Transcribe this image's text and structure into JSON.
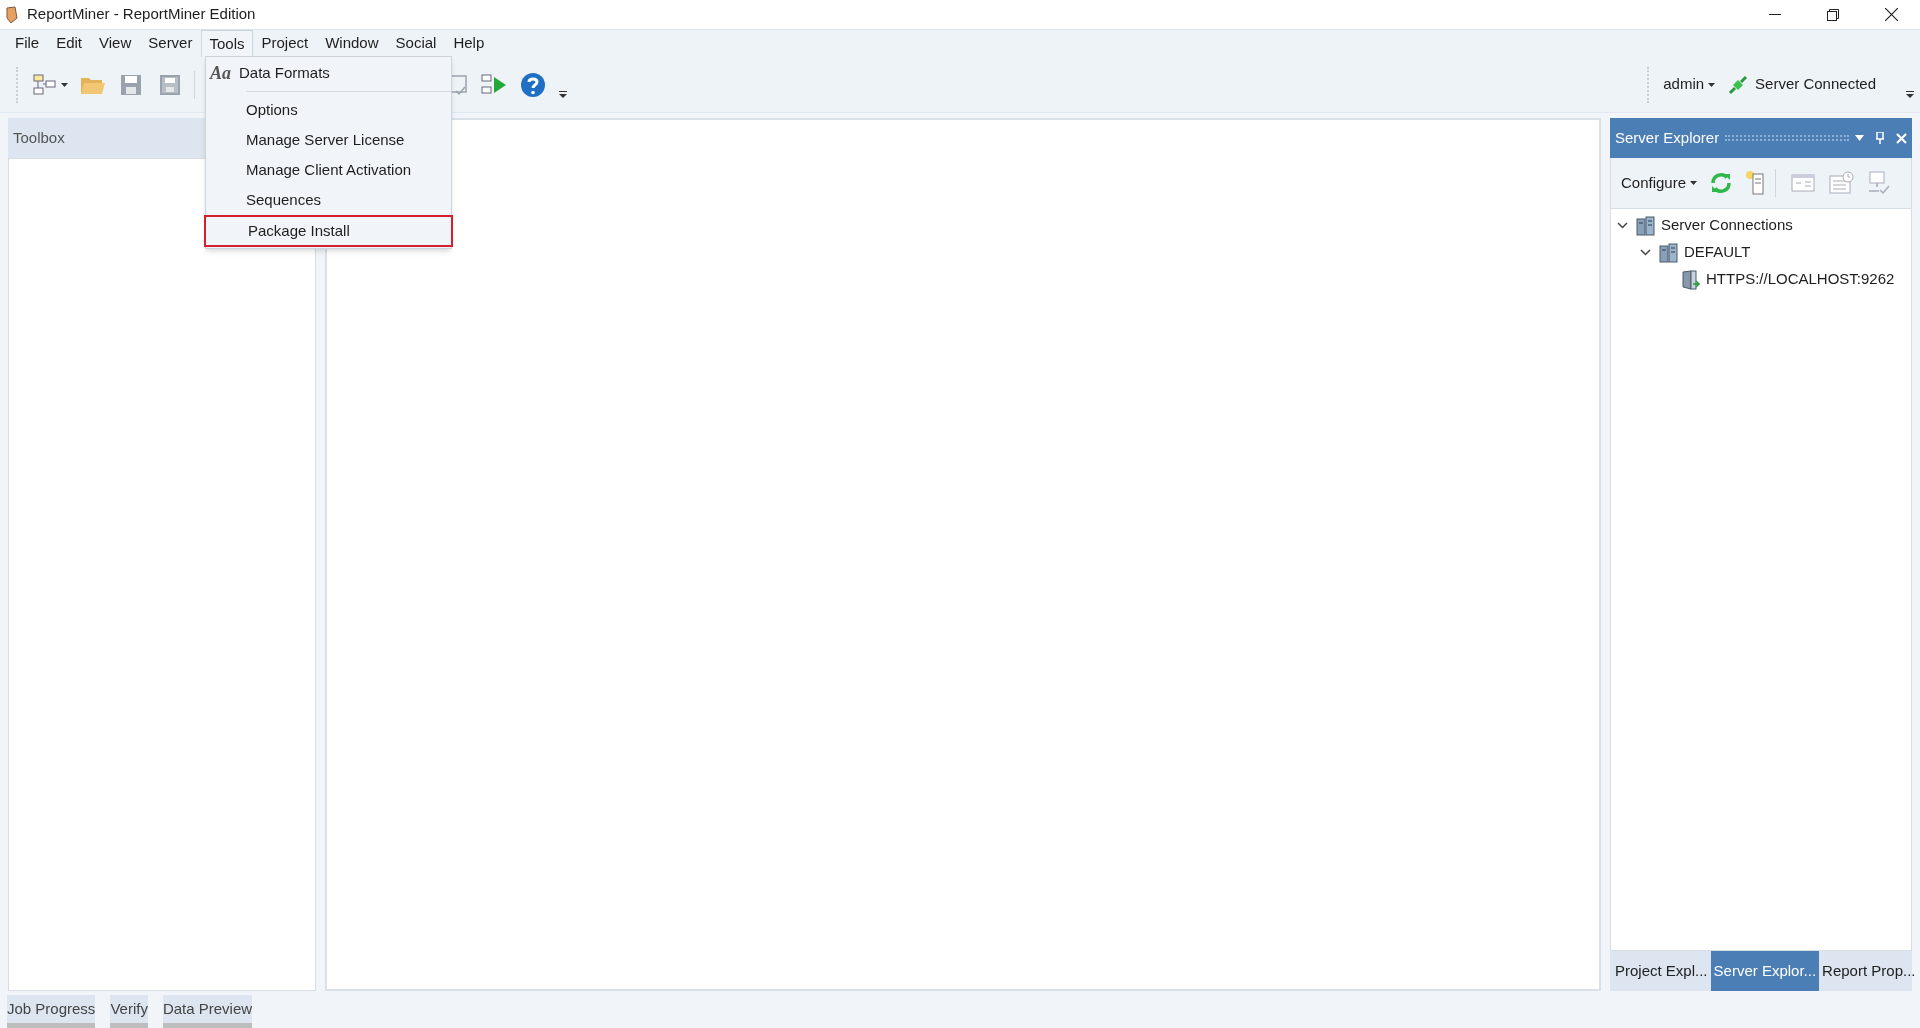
{
  "window": {
    "title": "ReportMiner - ReportMiner Edition"
  },
  "menu_bar": [
    {
      "label": "File",
      "selected": false
    },
    {
      "label": "Edit",
      "selected": false
    },
    {
      "label": "View",
      "selected": false
    },
    {
      "label": "Server",
      "selected": false
    },
    {
      "label": "Tools",
      "selected": true
    },
    {
      "label": "Project",
      "selected": false
    },
    {
      "label": "Window",
      "selected": false
    },
    {
      "label": "Social",
      "selected": false
    },
    {
      "label": "Help",
      "selected": false
    }
  ],
  "tools_menu": [
    {
      "kind": "item",
      "label": "Data Formats",
      "icon": "Aa",
      "highlighted": false
    },
    {
      "kind": "separator"
    },
    {
      "kind": "item",
      "label": "Options",
      "highlighted": false
    },
    {
      "kind": "item",
      "label": "Manage Server License",
      "highlighted": false
    },
    {
      "kind": "item",
      "label": "Manage Client Activation",
      "highlighted": false
    },
    {
      "kind": "item",
      "label": "Sequences",
      "highlighted": false
    },
    {
      "kind": "item",
      "label": "Package Install",
      "highlighted": true
    }
  ],
  "toolbar": {
    "user": "admin",
    "status": "Server Connected"
  },
  "toolbox": {
    "title": "Toolbox"
  },
  "server_explorer": {
    "title": "Server Explorer",
    "configure": "Configure",
    "tree": [
      {
        "label": "Server Connections",
        "expanded": true,
        "children": [
          {
            "label": "DEFAULT",
            "expanded": true,
            "children": [
              {
                "label": "HTTPS://LOCALHOST:9262"
              }
            ]
          }
        ]
      }
    ]
  },
  "right_tabs": [
    {
      "label": "Project Expl...",
      "selected": false
    },
    {
      "label": "Server Explor...",
      "selected": true
    },
    {
      "label": "Report Prop...",
      "selected": false
    }
  ],
  "bottom_tabs": [
    {
      "label": "Job Progress"
    },
    {
      "label": "Verify"
    },
    {
      "label": "Data Preview"
    }
  ]
}
